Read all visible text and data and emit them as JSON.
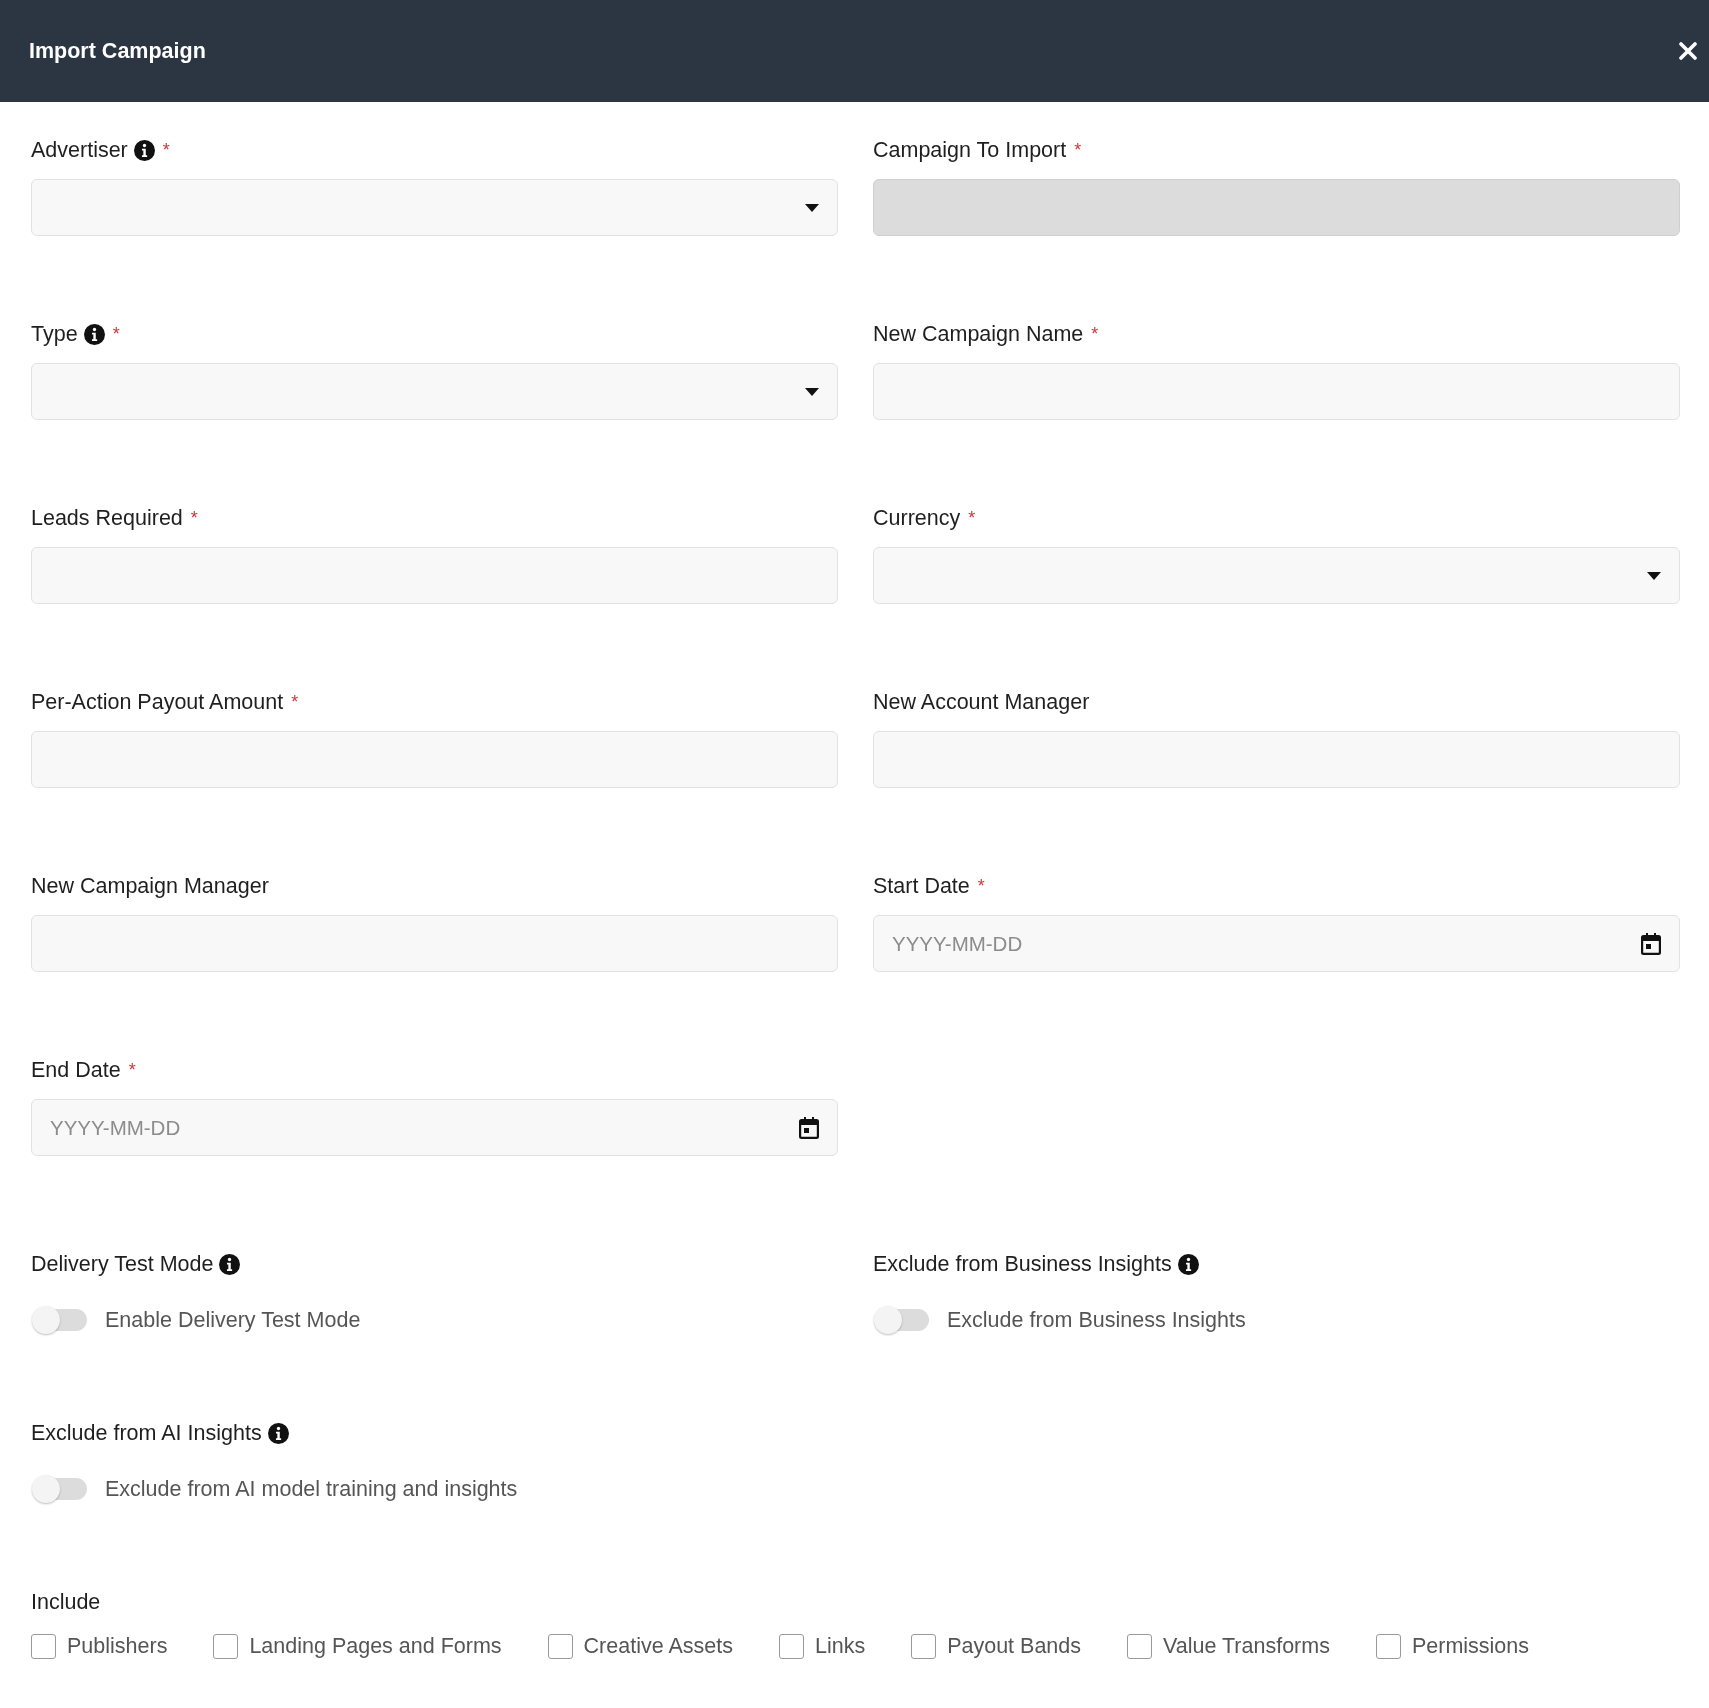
{
  "dialog": {
    "title": "Import Campaign"
  },
  "fields": [
    {
      "label": "Advertiser",
      "info": true,
      "required_mark": "*",
      "kind": "select",
      "disabled": false
    },
    {
      "label": "Campaign To Import",
      "info": false,
      "required_mark": "*",
      "kind": "text",
      "disabled": true
    },
    {
      "label": "Type",
      "info": true,
      "required_mark": "*",
      "kind": "select",
      "disabled": false
    },
    {
      "label": "New Campaign Name",
      "info": false,
      "required_mark": "*",
      "kind": "text",
      "disabled": false
    },
    {
      "label": "Leads Required",
      "info": false,
      "required_mark": "*",
      "kind": "text",
      "disabled": false
    },
    {
      "label": "Currency",
      "info": false,
      "required_mark": "*",
      "kind": "select",
      "disabled": false
    },
    {
      "label": "Per-Action Payout Amount",
      "info": false,
      "required_mark": "*",
      "kind": "text",
      "disabled": false
    },
    {
      "label": "New Account Manager",
      "info": false,
      "kind": "text",
      "disabled": false
    },
    {
      "label": "New Campaign Manager",
      "info": false,
      "kind": "text",
      "disabled": false
    },
    {
      "label": "Start Date",
      "info": false,
      "required_mark": "*",
      "kind": "date",
      "placeholder": "YYYY-MM-DD",
      "disabled": false
    },
    {
      "label": "End Date",
      "info": false,
      "required_mark": "*",
      "kind": "date",
      "placeholder": "YYYY-MM-DD",
      "disabled": false
    }
  ],
  "toggles": [
    {
      "label": "Delivery Test Mode",
      "info": true,
      "on": false,
      "text": "Enable Delivery Test Mode"
    },
    {
      "label": "Exclude from Business Insights",
      "info": true,
      "on": false,
      "text": "Exclude from Business Insights"
    },
    {
      "label": "Exclude from AI Insights",
      "info": true,
      "on": false,
      "text": "Exclude from AI model training and insights"
    }
  ],
  "include": {
    "label": "Include",
    "options": [
      {
        "label": "Publishers",
        "checked": false
      },
      {
        "label": "Landing Pages and Forms",
        "checked": false
      },
      {
        "label": "Creative Assets",
        "checked": false
      },
      {
        "label": "Links",
        "checked": false
      },
      {
        "label": "Payout Bands",
        "checked": false
      },
      {
        "label": "Value Transforms",
        "checked": false
      },
      {
        "label": "Permissions",
        "checked": false
      }
    ]
  }
}
